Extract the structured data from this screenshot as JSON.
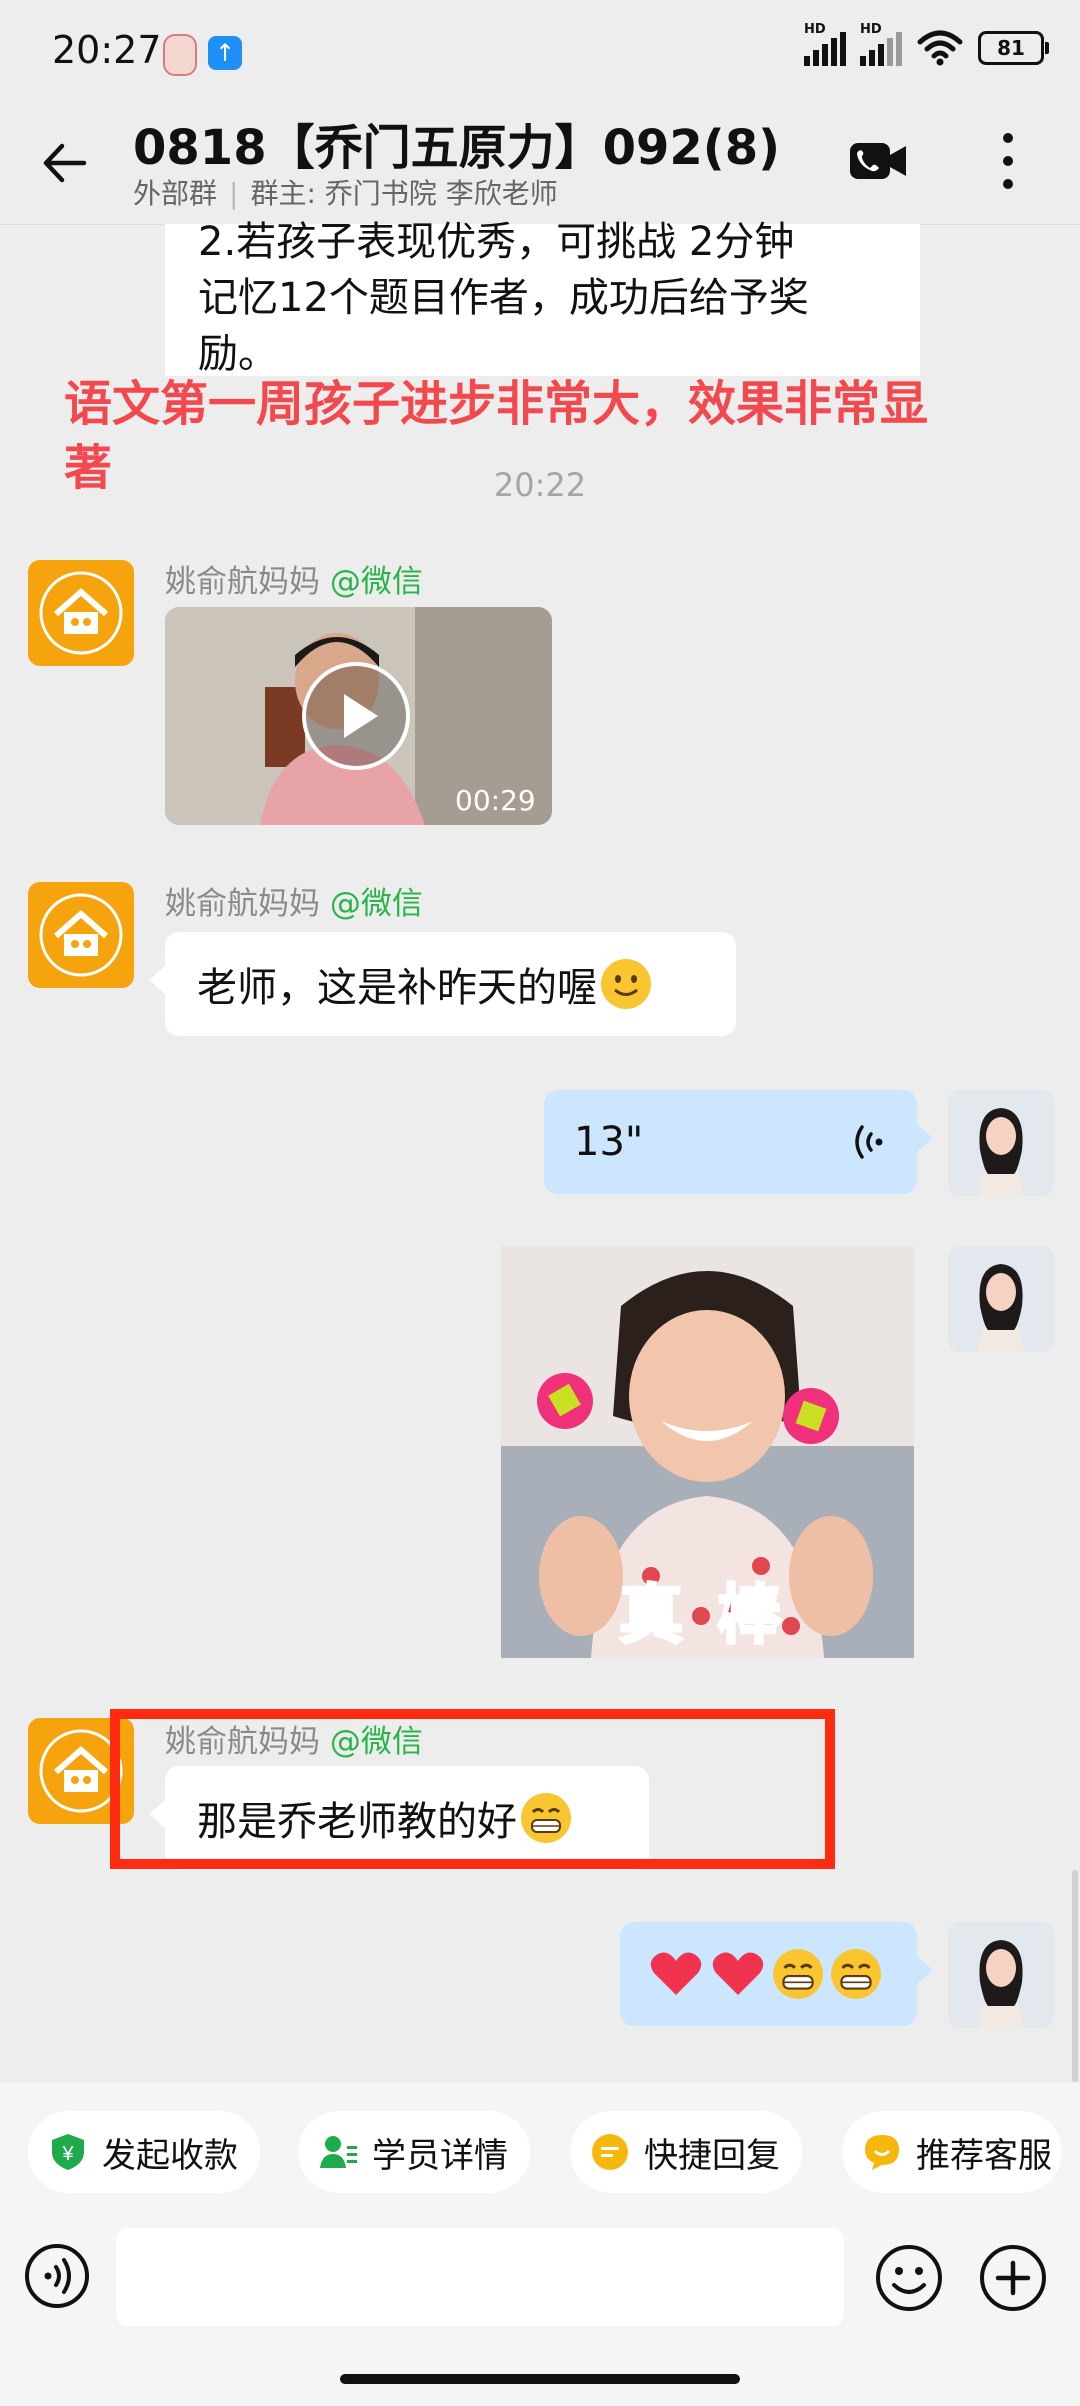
{
  "status_bar": {
    "time": "20:27",
    "battery": "81",
    "network_1": "HD",
    "network_2": "HD"
  },
  "header": {
    "title": "0818【乔门五原力】092(8)",
    "group_type": "外部群",
    "owner": "群主: 乔门书院 李欣老师"
  },
  "messages": {
    "top_text_lines": [
      "2.若孩子表现优秀，可挑战 2分钟",
      "记忆12个题目作者，成功后给予奖",
      "励。"
    ],
    "red_note": "语文第一周孩子进步非常大，效果非常显著",
    "timestamp": "20:22",
    "sender_name": "姚俞航妈妈",
    "sender_source": "@微信",
    "video_duration": "00:29",
    "text_1": "老师，这是补昨天的喔",
    "voice_length": "13\"",
    "sticker_caption": "真 棒",
    "text_2": "那是乔老师教的好",
    "icons": {
      "video_play": "play-icon",
      "voice_wave": "voice-wave-icon",
      "emoji_smile": "smile-emoji",
      "emoji_grin": "grin-emoji",
      "emoji_heart": "heart-emoji"
    }
  },
  "quick_actions": {
    "collect": "发起收款",
    "student": "学员详情",
    "reply": "快捷回复",
    "service": "推荐客服"
  },
  "input": {
    "placeholder": ""
  },
  "colors": {
    "accent_green": "#27b54a",
    "red_note": "#f2494e",
    "highlight_box": "#ff2b10",
    "outgoing_bubble": "#cce6ff"
  }
}
